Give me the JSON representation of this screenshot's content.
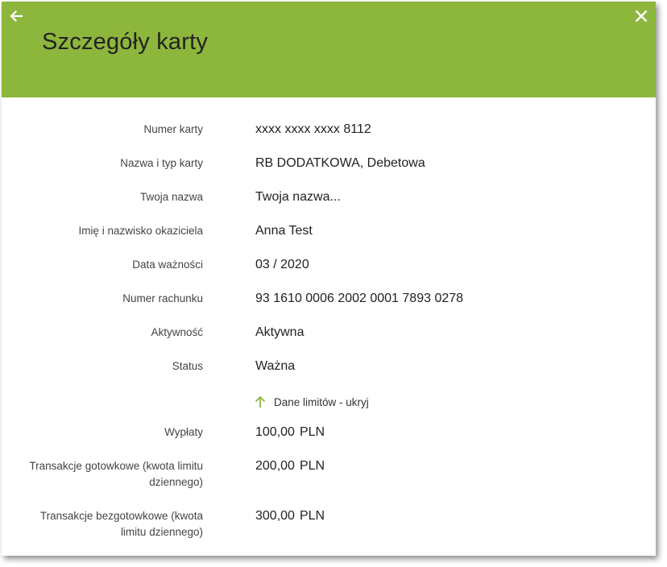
{
  "header": {
    "title": "Szczegóły karty",
    "color": "#8db63d",
    "back_icon": "arrow-left-icon",
    "close_icon": "close-icon"
  },
  "details": [
    {
      "label": "Numer karty",
      "value": "xxxx xxxx xxxx 8112"
    },
    {
      "label": "Nazwa i typ karty",
      "value": "RB DODATKOWA, Debetowa"
    },
    {
      "label": "Twoja nazwa",
      "value": "Twoja nazwa..."
    },
    {
      "label": "Imię i nazwisko okaziciela",
      "value": "Anna Test"
    },
    {
      "label": "Data ważności",
      "value": "03 / 2020"
    },
    {
      "label": "Numer rachunku",
      "value": "93 1610 0006 2002 0001 7893 0278"
    },
    {
      "label": "Aktywność",
      "value": "Aktywna"
    },
    {
      "label": "Status",
      "value": "Ważna"
    }
  ],
  "limits_toggle": {
    "label": "Dane limitów - ukryj",
    "icon": "arrow-up-icon",
    "icon_color": "#8db63d"
  },
  "limits": [
    {
      "label_line1": "Wypłaty",
      "label_line2": "",
      "amount": "100,00",
      "currency": "PLN"
    },
    {
      "label_line1": "Transakcje gotowkowe (kwota limitu",
      "label_line2": "dziennego)",
      "amount": "200,00",
      "currency": "PLN"
    },
    {
      "label_line1": "Transakcje bezgotowkowe (kwota",
      "label_line2": "limitu dziennego)",
      "amount": "300,00",
      "currency": "PLN"
    }
  ]
}
